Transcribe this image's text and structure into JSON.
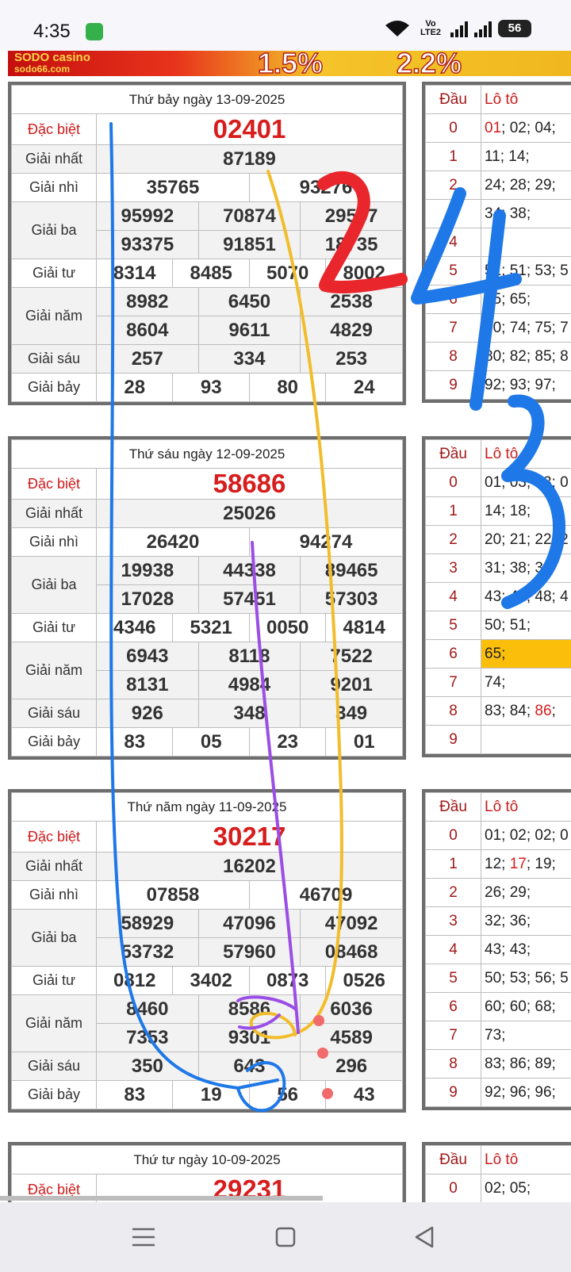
{
  "status_bar": {
    "time": "4:35",
    "network_label": "Vo LTE2",
    "battery_level": "56"
  },
  "banner": {
    "brand": "SODO casino",
    "site": "sodo66.com",
    "promo1": "1.5%",
    "promo2": "2.2%"
  },
  "draws": [
    {
      "date": "Thứ bảy ngày 13-09-2025",
      "special": "02401",
      "first": "87189",
      "second": [
        "35765",
        "93276"
      ],
      "third": [
        "95992",
        "70874",
        "29587",
        "93375",
        "91851",
        "18735"
      ],
      "fourth": [
        "8314",
        "8485",
        "5070",
        "8002"
      ],
      "fifth": [
        "8982",
        "6450",
        "2538",
        "8604",
        "9611",
        "4829"
      ],
      "sixth": [
        "257",
        "334",
        "253"
      ],
      "seventh": [
        "28",
        "93",
        "80",
        "24"
      ],
      "loto": [
        {
          "dau": "0",
          "parts": [
            {
              "t": "01",
              "red": true
            },
            {
              "t": "; 02; 04;"
            }
          ]
        },
        {
          "dau": "1",
          "parts": [
            {
              "t": "11; 14;"
            }
          ]
        },
        {
          "dau": "2",
          "parts": [
            {
              "t": "24; 28; 29;"
            }
          ]
        },
        {
          "dau": "3",
          "parts": [
            {
              "t": "34; 38;"
            }
          ]
        },
        {
          "dau": "4",
          "parts": [
            {
              "t": ""
            }
          ]
        },
        {
          "dau": "5",
          "parts": [
            {
              "t": "51; 51; 53; 5"
            }
          ]
        },
        {
          "dau": "6",
          "parts": [
            {
              "t": "65; 65;"
            }
          ]
        },
        {
          "dau": "7",
          "parts": [
            {
              "t": "70; 74; 75; 7"
            }
          ]
        },
        {
          "dau": "8",
          "parts": [
            {
              "t": "80; 82; 85; 8"
            }
          ]
        },
        {
          "dau": "9",
          "parts": [
            {
              "t": "92; 93; 97;"
            }
          ]
        }
      ]
    },
    {
      "date": "Thứ sáu ngày 12-09-2025",
      "special": "58686",
      "first": "25026",
      "second": [
        "26420",
        "94274"
      ],
      "third": [
        "19938",
        "44338",
        "89465",
        "17028",
        "57451",
        "57303"
      ],
      "fourth": [
        "4346",
        "5321",
        "0050",
        "4814"
      ],
      "fifth": [
        "6943",
        "8118",
        "7522",
        "8131",
        "4984",
        "9201"
      ],
      "sixth": [
        "926",
        "348",
        "349"
      ],
      "seventh": [
        "83",
        "05",
        "23",
        "01"
      ],
      "loto": [
        {
          "dau": "0",
          "parts": [
            {
              "t": "01; 03; 03; 0"
            }
          ]
        },
        {
          "dau": "1",
          "parts": [
            {
              "t": "14; 18;"
            }
          ]
        },
        {
          "dau": "2",
          "parts": [
            {
              "t": "20; 21; 22; 2"
            }
          ]
        },
        {
          "dau": "3",
          "parts": [
            {
              "t": "31; 38; 38"
            }
          ]
        },
        {
          "dau": "4",
          "parts": [
            {
              "t": "43; 46; 48; 4"
            }
          ]
        },
        {
          "dau": "5",
          "parts": [
            {
              "t": "50; 51;"
            }
          ]
        },
        {
          "dau": "6",
          "parts": [
            {
              "t": "65;"
            }
          ],
          "highlight": true
        },
        {
          "dau": "7",
          "parts": [
            {
              "t": "74;"
            }
          ]
        },
        {
          "dau": "8",
          "parts": [
            {
              "t": "83; 84; "
            },
            {
              "t": "86",
              "red": true
            },
            {
              "t": ";"
            }
          ]
        },
        {
          "dau": "9",
          "parts": [
            {
              "t": ""
            }
          ]
        }
      ]
    },
    {
      "date": "Thứ năm ngày 11-09-2025",
      "special": "30217",
      "first": "16202",
      "second": [
        "07858",
        "46709"
      ],
      "third": [
        "58929",
        "47096",
        "47092",
        "53732",
        "57960",
        "08468"
      ],
      "fourth": [
        "0812",
        "3402",
        "0873",
        "0526"
      ],
      "fifth": [
        "8460",
        "8586",
        "6036",
        "7353",
        "9301",
        "4589"
      ],
      "sixth": [
        "350",
        "643",
        "296"
      ],
      "seventh": [
        "83",
        "19",
        "56",
        "43"
      ],
      "loto": [
        {
          "dau": "0",
          "parts": [
            {
              "t": "01; 02; 02; 0"
            }
          ]
        },
        {
          "dau": "1",
          "parts": [
            {
              "t": "12; "
            },
            {
              "t": "17",
              "red": true
            },
            {
              "t": "; 19;"
            }
          ]
        },
        {
          "dau": "2",
          "parts": [
            {
              "t": "26; 29;"
            }
          ]
        },
        {
          "dau": "3",
          "parts": [
            {
              "t": "32; 36;"
            }
          ]
        },
        {
          "dau": "4",
          "parts": [
            {
              "t": "43; 43;"
            }
          ]
        },
        {
          "dau": "5",
          "parts": [
            {
              "t": "50; 53; 56; 5"
            }
          ]
        },
        {
          "dau": "6",
          "parts": [
            {
              "t": "60; 60; 68;"
            }
          ]
        },
        {
          "dau": "7",
          "parts": [
            {
              "t": "73;"
            }
          ]
        },
        {
          "dau": "8",
          "parts": [
            {
              "t": "83; 86; 89;"
            }
          ]
        },
        {
          "dau": "9",
          "parts": [
            {
              "t": "92; 96; 96;"
            }
          ]
        }
      ]
    },
    {
      "date": "Thứ tư ngày 10-09-2025",
      "special": "29231",
      "loto": [
        {
          "dau": "0",
          "parts": [
            {
              "t": "02; 05;"
            }
          ]
        }
      ]
    }
  ],
  "labels": {
    "special": "Đặc biệt",
    "first": "Giải nhất",
    "second": "Giải nhì",
    "third": "Giải ba",
    "fourth": "Giải tư",
    "fifth": "Giải năm",
    "sixth": "Giải sáu",
    "seventh": "Giải bảy",
    "loto_dau": "Đầu",
    "loto_list": "Lô tô"
  },
  "handwriting": {
    "text": "2435",
    "colors": {
      "blue": "#1e78e8",
      "yellow": "#f2bd2c",
      "purple": "#9b4ee6",
      "pink": "#f26b6b"
    }
  },
  "colors": {
    "accent_red": "#d71d1d",
    "highlight": "#fbbf0b",
    "border": "#6e6e6e"
  }
}
